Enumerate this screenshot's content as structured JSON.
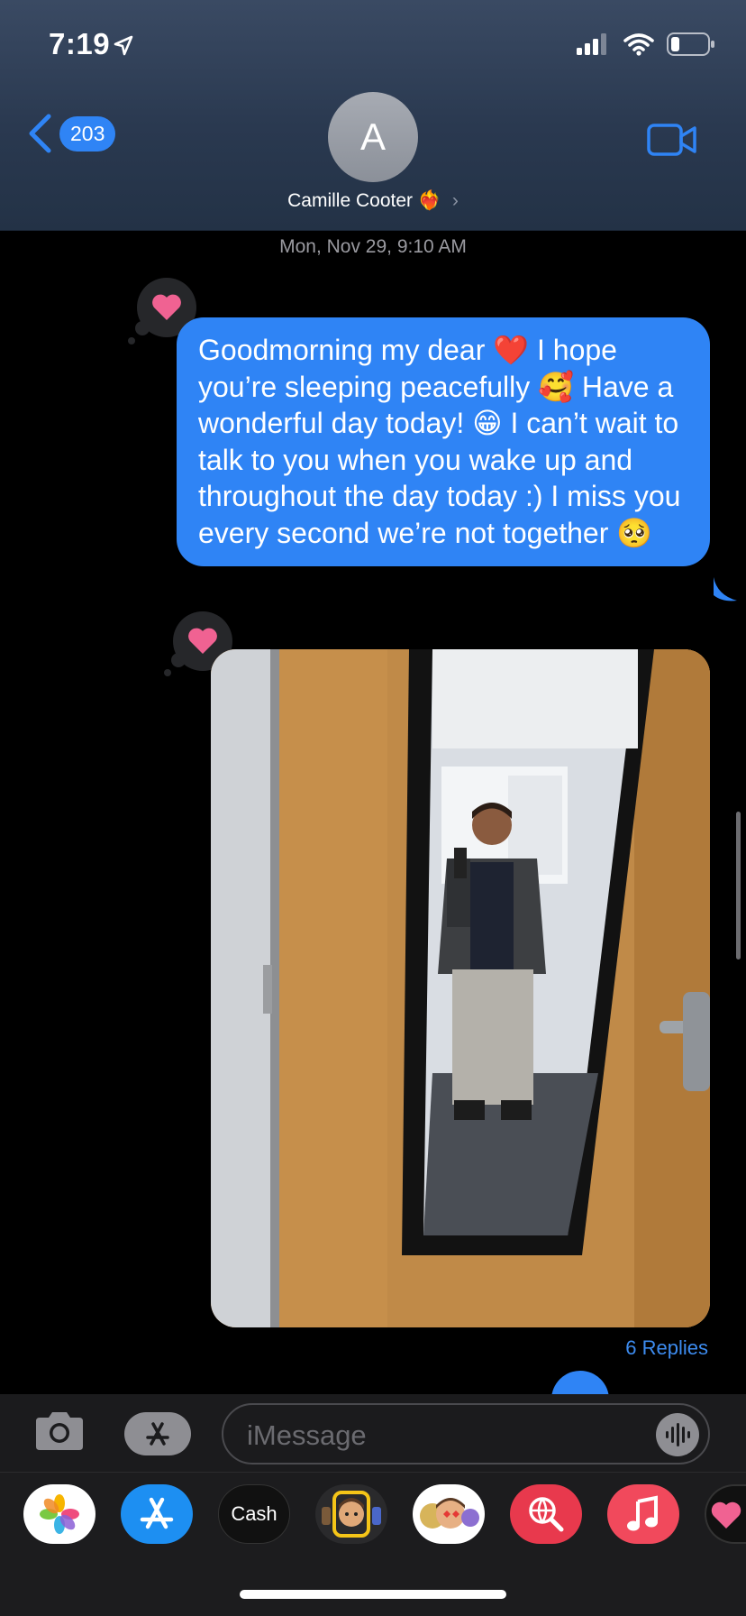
{
  "status_bar": {
    "time": "7:19"
  },
  "header": {
    "back_count": "203",
    "avatar_initial": "A",
    "contact_name": "Camille Cooter ❤️‍🔥"
  },
  "thread": {
    "timestamp": "Mon, Nov 29, 9:10 AM",
    "message_text": "Goodmorning my dear ❤️ I hope you’re sleeping peacefully 🥰 Have a wonderful day today! 😁 I can’t wait to talk to you when you wake up and throughout the day today :) I miss you every second we’re not together 🥺",
    "replies_label": "6 Replies",
    "tapback_icon": "heart"
  },
  "compose": {
    "placeholder": "iMessage"
  },
  "app_drawer": {
    "items": [
      "photos",
      "app-store",
      "Cash",
      "memoji-stickers",
      "animoji",
      "search-images",
      "music",
      "heart-app"
    ],
    "cash_label": "Cash"
  },
  "colors": {
    "bubble": "#2f84f5",
    "accent": "#3d8cf0",
    "heart": "#f06292"
  }
}
